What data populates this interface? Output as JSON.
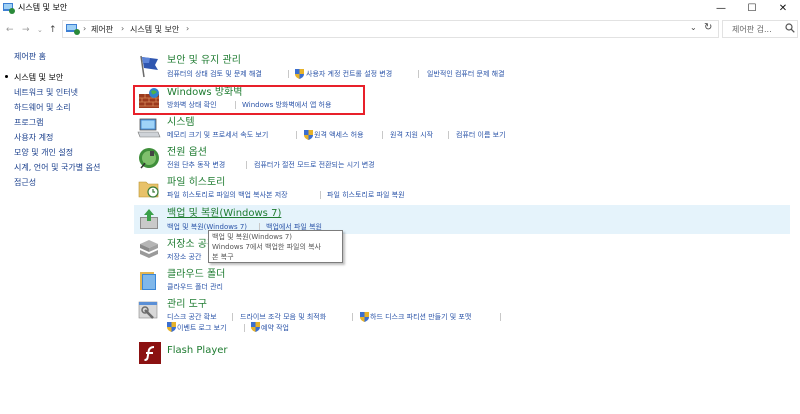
{
  "window": {
    "title": "시스템 및 보안",
    "minimize": "—",
    "maximize": "☐",
    "close": "✕"
  },
  "address": {
    "back": "←",
    "forward": "→",
    "recent": "⌄",
    "up": "↑",
    "crumbs": [
      "제어판",
      "시스템 및 보안"
    ],
    "separator": "›",
    "dropdown": "⌄",
    "refresh": "↻",
    "search_placeholder": "제어판 검..."
  },
  "sidebar": {
    "items": [
      {
        "label": "제어판 홈"
      },
      {
        "label": "시스템 및 보안"
      },
      {
        "label": "네트워크 및 인터넷"
      },
      {
        "label": "하드웨어 및 소리"
      },
      {
        "label": "프로그램"
      },
      {
        "label": "사용자 계정"
      },
      {
        "label": "모양 및 개인 설정"
      },
      {
        "label": "시계, 언어 및 국가별 옵션"
      },
      {
        "label": "접근성"
      }
    ]
  },
  "categories": [
    {
      "title": "보안 및 유지 관리",
      "links": [
        "컴퓨터의 상태 검토 및 문제 해결",
        "사용자 계정 컨트롤 설정 변경",
        "일반적인 컴퓨터 문제 해결"
      ]
    },
    {
      "title": "Windows 방화벽",
      "links": [
        "방화벽 상태 확인",
        "Windows 방화벽에서 앱 허용"
      ]
    },
    {
      "title": "시스템",
      "links": [
        "메모리 크기 및 프로세서 속도 보기",
        "원격 액세스 허용",
        "원격 지원 시작",
        "컴퓨터 이름 보기"
      ]
    },
    {
      "title": "전원 옵션",
      "links": [
        "전원 단추 동작 변경",
        "컴퓨터가 절전 모드로 전환되는 시기 변경"
      ]
    },
    {
      "title": "파일 히스토리",
      "links": [
        "파일 히스토리로 파일의 백업 복사본 저장",
        "파일 히스토리로 파일 복원"
      ]
    },
    {
      "title": "백업 및 복원(Windows 7)",
      "links": [
        "백업 및 복원(Windows 7)",
        "백업에서 파일 복원"
      ]
    },
    {
      "title": "저장소 공간",
      "links": [
        "저장소 공간"
      ]
    },
    {
      "title": "클라우드 폴더",
      "links": [
        "클라우드 폴더 관리"
      ]
    },
    {
      "title": "관리 도구",
      "links": [
        "디스크 공간 확보",
        "드라이브 조각 모음 및 최적화",
        "하드 디스크 파티션 만들기 및 포맷",
        "이벤트 로그 보기",
        "예약 작업"
      ]
    },
    {
      "title": "Flash Player",
      "links": []
    }
  ],
  "tooltip": {
    "lines": [
      "백업 및 복원(Windows 7)",
      "Windows 7에서 백업한 파일의 복사",
      "본 복구"
    ]
  },
  "colors": {
    "category_title": "#1e7b30",
    "link": "#2b54a8",
    "highlight": "#e8202a",
    "hover": "#e5f3fb"
  }
}
